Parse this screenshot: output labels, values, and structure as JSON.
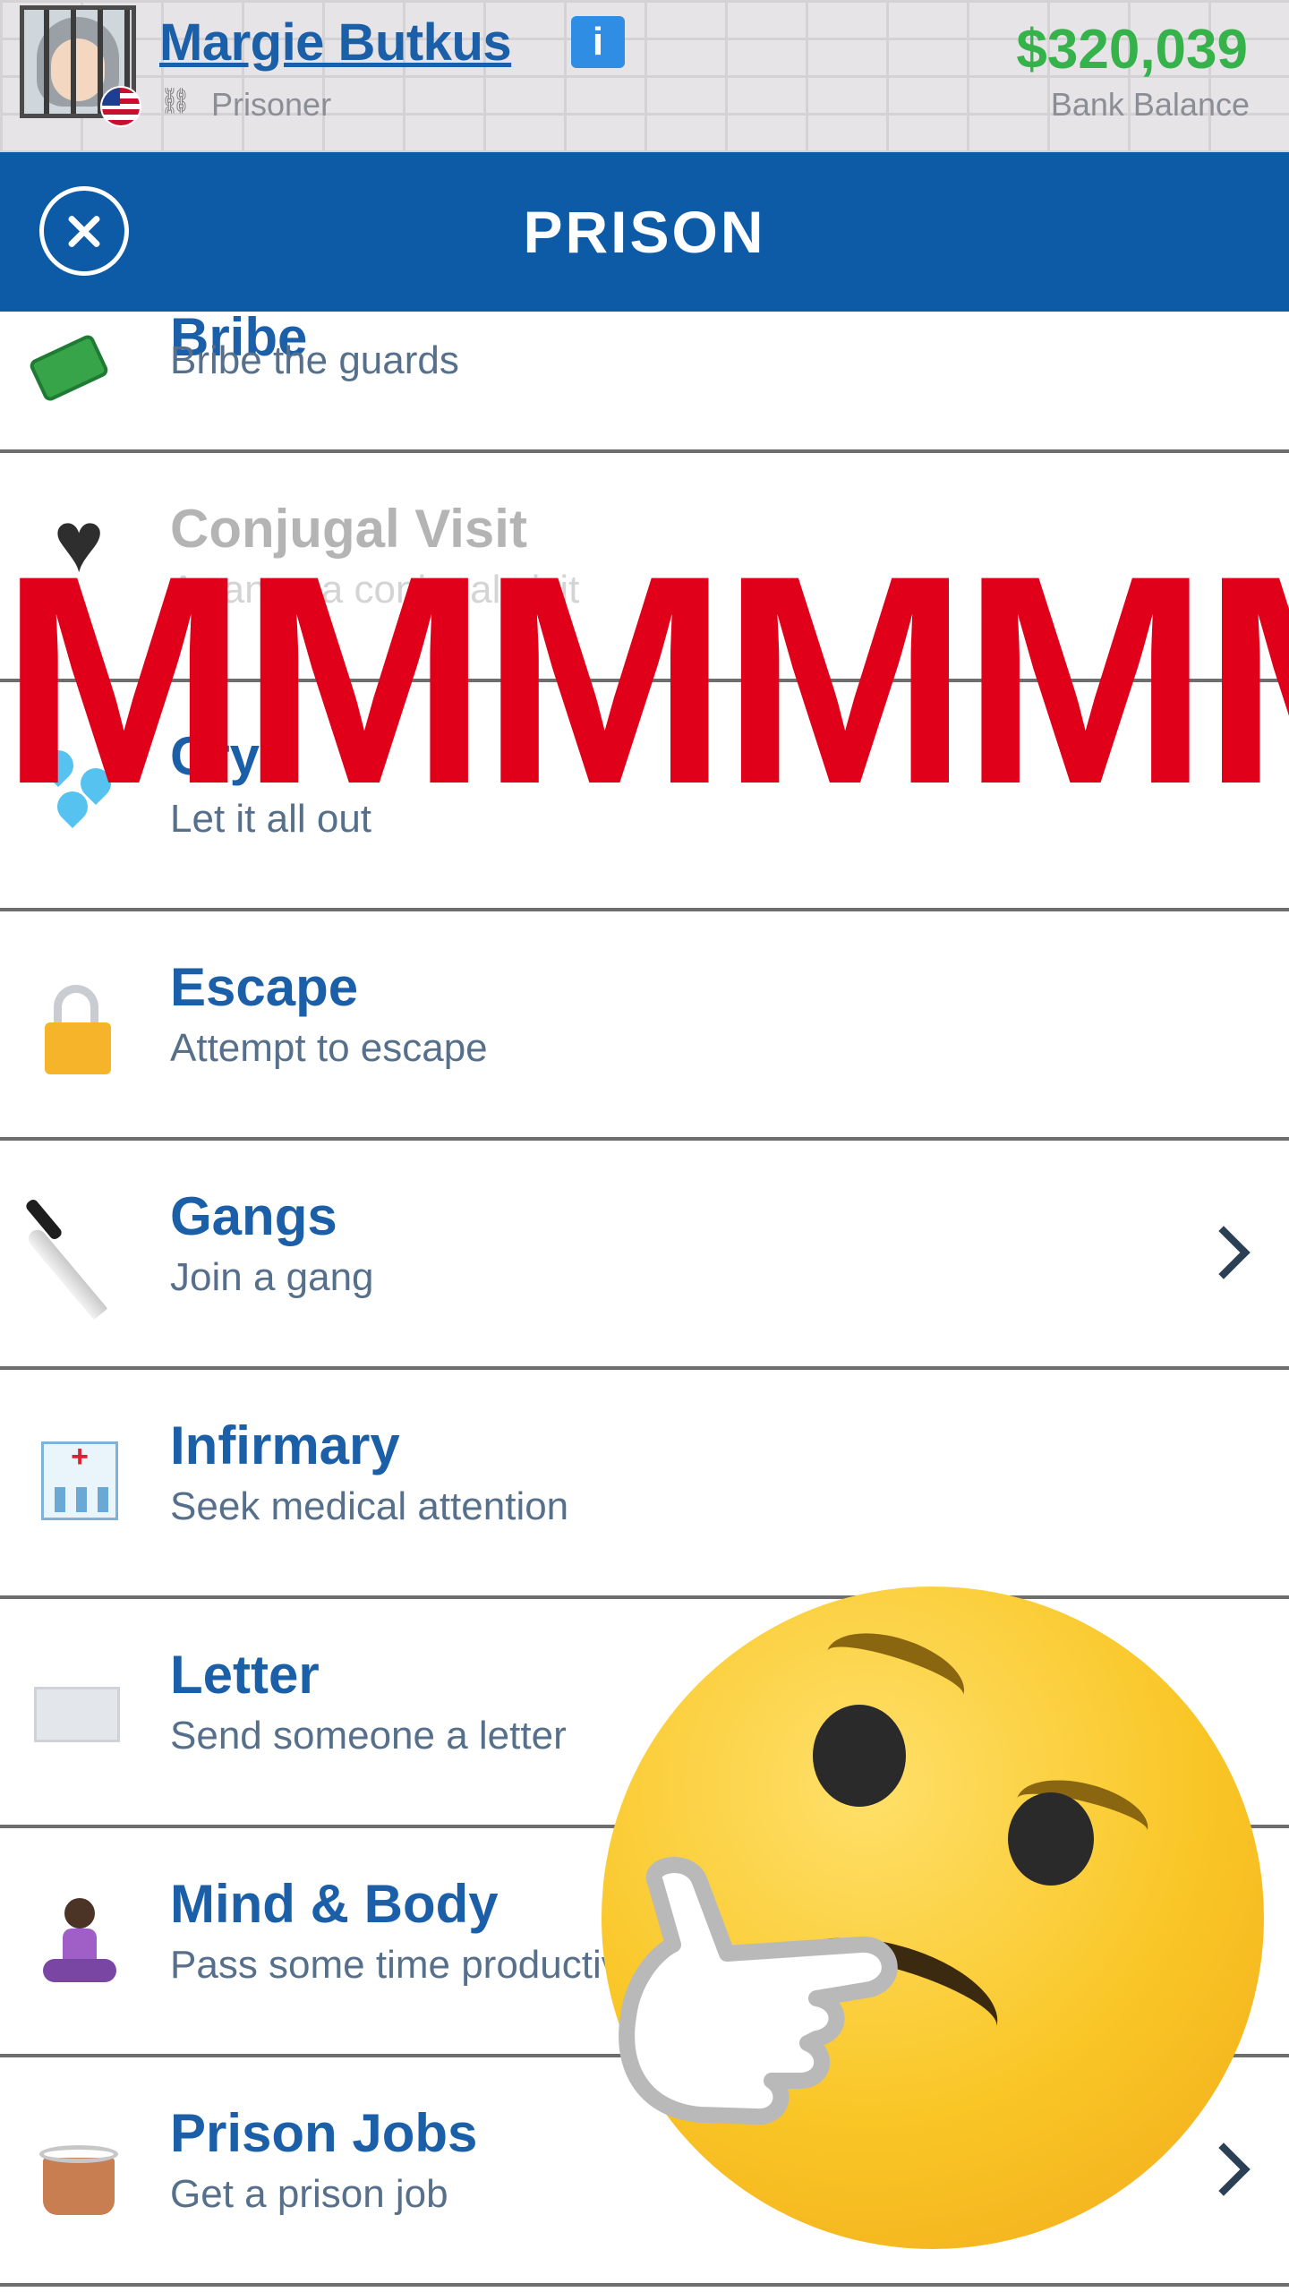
{
  "header": {
    "player_name": "Margie Butkus",
    "info_badge": "i",
    "role_icon": "handcuffs-icon",
    "role": "Prisoner",
    "bank_balance": "$320,039",
    "bank_balance_label": "Bank Balance",
    "balance_color": "#35b24a"
  },
  "titlebar": {
    "title": "PRISON",
    "close_icon": "close-icon",
    "background": "#0d5aa6"
  },
  "rows": [
    {
      "id": "bribe",
      "label": "Bribe",
      "subtitle": "Bribe the guards",
      "icon": "money-icon",
      "chevron": false
    },
    {
      "id": "conjugal",
      "label": "Conjugal Visit",
      "subtitle": "Arrange a conjugal visit",
      "icon": "black-heart-icon",
      "chevron": false,
      "disabled": true
    },
    {
      "id": "cry",
      "label": "Cry",
      "subtitle": "Let it all out",
      "icon": "sweat-droplets-icon",
      "chevron": false
    },
    {
      "id": "escape",
      "label": "Escape",
      "subtitle": "Attempt to escape",
      "icon": "lock-icon",
      "chevron": false
    },
    {
      "id": "gangs",
      "label": "Gangs",
      "subtitle": "Join a gang",
      "icon": "knife-icon",
      "chevron": true
    },
    {
      "id": "infirmary",
      "label": "Infirmary",
      "subtitle": "Seek medical attention",
      "icon": "hospital-icon",
      "chevron": false
    },
    {
      "id": "letter",
      "label": "Letter",
      "subtitle": "Send someone a letter",
      "icon": "envelope-icon",
      "chevron": false
    },
    {
      "id": "mind_body",
      "label": "Mind & Body",
      "subtitle": "Pass some time productively",
      "icon": "yoga-icon",
      "chevron": false
    },
    {
      "id": "prison_jobs",
      "label": "Prison Jobs",
      "subtitle": "Get a prison job",
      "icon": "laundry-basket-icon",
      "chevron": true
    }
  ],
  "overlay": {
    "text": "MMMMMMM",
    "color": "#e0001a",
    "emoji": "thinking-face-emoji"
  }
}
